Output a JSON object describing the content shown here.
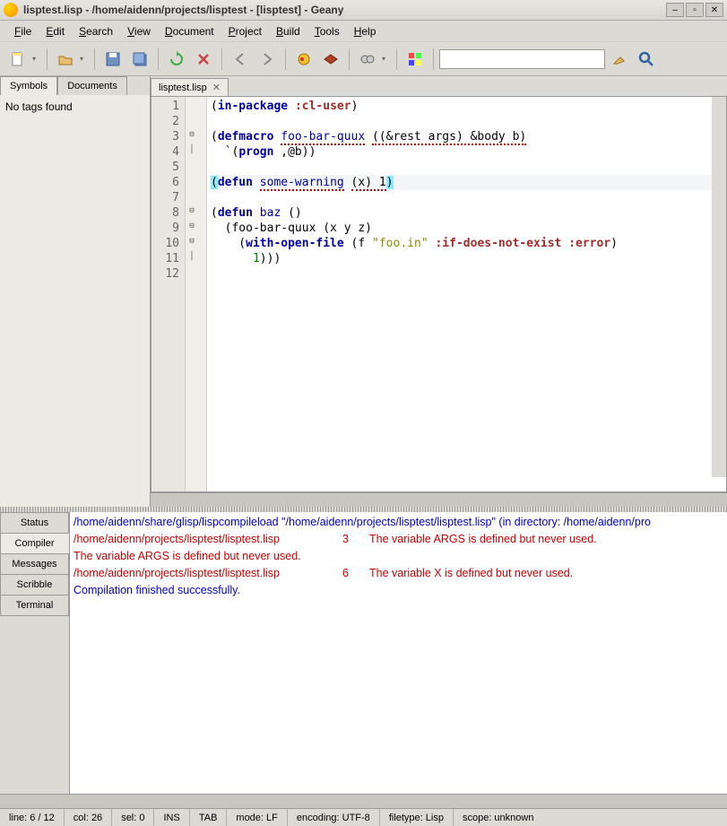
{
  "titlebar": {
    "title": "lisptest.lisp - /home/aidenn/projects/lisptest - [lisptest] - Geany"
  },
  "menubar": [
    "File",
    "Edit",
    "Search",
    "View",
    "Document",
    "Project",
    "Build",
    "Tools",
    "Help"
  ],
  "sidebar": {
    "tabs": [
      "Symbols",
      "Documents"
    ],
    "active": 0,
    "body": "No tags found"
  },
  "file_tabs": [
    {
      "label": "lisptest.lisp"
    }
  ],
  "code": {
    "lines": [
      {
        "n": 1,
        "fold": "",
        "html": "(<span class='kw'>in-package</span> <span class='sym'>:cl-user</span>)"
      },
      {
        "n": 2,
        "fold": "",
        "html": ""
      },
      {
        "n": 3,
        "fold": "⊟",
        "html": "(<span class='kw'>defmacro</span> <span class='fnname err'>foo-bar-quux</span> <span class='err'>((&rest args) &body b)</span>"
      },
      {
        "n": 4,
        "fold": "│",
        "html": "  `(<span class='kw'>progn</span> ,@b))"
      },
      {
        "n": 5,
        "fold": "",
        "html": ""
      },
      {
        "n": 6,
        "fold": "",
        "hl": true,
        "html": "<span class='paren-hl'>(</span><span class='kw'>defun</span> <span class='fnname err'>some-warning</span> <span class='err'>(x) 1</span><span class='paren-hl'>)</span>"
      },
      {
        "n": 7,
        "fold": "",
        "html": ""
      },
      {
        "n": 8,
        "fold": "⊟",
        "html": "(<span class='kw'>defun</span> <span class='fnname'>baz</span> ()"
      },
      {
        "n": 9,
        "fold": "⊟",
        "html": "  (foo-bar-quux (x y z)"
      },
      {
        "n": 10,
        "fold": "⊟",
        "html": "    (<span class='kw'>with-open-file</span> (f <span class='str'>\"foo.in\"</span> <span class='sym'>:if-does-not-exist</span> <span class='sym'>:error</span>)"
      },
      {
        "n": 11,
        "fold": "│",
        "html": "      <span class='num'>1</span>)))"
      },
      {
        "n": 12,
        "fold": "",
        "html": ""
      }
    ]
  },
  "msg_tabs": [
    "Status",
    "Compiler",
    "Messages",
    "Scribble",
    "Terminal"
  ],
  "msg_active": 1,
  "messages": [
    {
      "cls": "msg-blue",
      "text": "/home/aidenn/share/glisp/lispcompileload \"/home/aidenn/projects/lisptest/lisptest.lisp\" (in directory: /home/aidenn/pro"
    },
    {
      "cls": "msg-red",
      "file": "/home/aidenn/projects/lisptest/lisptest.lisp",
      "line": "3",
      "msg": "The variable ARGS is defined but never used."
    },
    {
      "cls": "msg-red",
      "text": "The variable ARGS is defined but never used."
    },
    {
      "cls": "msg-red",
      "file": "/home/aidenn/projects/lisptest/lisptest.lisp",
      "line": "6",
      "msg": "The variable X is defined but never used."
    },
    {
      "cls": "msg-blue",
      "text": "Compilation finished successfully."
    }
  ],
  "statusbar": {
    "pos": "line: 6 / 12",
    "col": "col: 26",
    "sel": "sel: 0",
    "ins": "INS",
    "tab": "TAB",
    "mode": "mode: LF",
    "enc": "encoding: UTF-8",
    "ftype": "filetype: Lisp",
    "scope": "scope: unknown"
  },
  "search": {
    "placeholder": ""
  }
}
